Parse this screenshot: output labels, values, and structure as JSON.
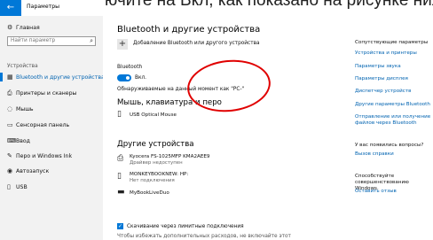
{
  "top_caption": "ючите на Вкл, как показано на рисунке ниже",
  "window": {
    "title": "Параметры"
  },
  "sidebar": {
    "home": "Главная",
    "search_placeholder": "Найти параметр",
    "section": "Устройства",
    "items": [
      {
        "label": "Bluetooth и другие устройства",
        "icon": "bluetooth-icon"
      },
      {
        "label": "Принтеры и сканеры",
        "icon": "printer-icon"
      },
      {
        "label": "Мышь",
        "icon": "mouse-icon"
      },
      {
        "label": "Сенсорная панель",
        "icon": "touchpad-icon"
      },
      {
        "label": "Ввод",
        "icon": "keyboard-icon"
      },
      {
        "label": "Перо и Windows Ink",
        "icon": "pen-icon"
      },
      {
        "label": "Автозапуск",
        "icon": "autoplay-icon"
      },
      {
        "label": "USB",
        "icon": "usb-icon"
      }
    ]
  },
  "main": {
    "title": "Bluetooth и другие устройства",
    "add_device": "Добавление Bluetooth или другого устройства",
    "bt_label": "Bluetooth",
    "bt_state": "Вкл.",
    "discoverable": "Обнаруживаемые на данный момент как \"PC-\"",
    "mouse_heading": "Мышь, клавиатура и перо",
    "mouse_device": "USB Optical Mouse",
    "other_heading": "Другие устройства",
    "devices": [
      {
        "name": "Kyocera FS-1025MFP KMA2AEE9",
        "status": "Драйвер недоступен"
      },
      {
        "name": "MONKEYBOOKNEW: HP:",
        "status": "Нет подключения"
      },
      {
        "name": "MyBookLiveDuo",
        "status": ""
      }
    ],
    "metered": "Скачивание через лимитные подключения",
    "metered_note": "Чтобы избежать дополнительных расходов, не включайте этот"
  },
  "right": {
    "related_heading": "Сопутствующие параметры",
    "links": [
      "Устройства и принтеры",
      "Параметры звука",
      "Параметры дисплея",
      "Диспетчер устройств",
      "Другие параметры Bluetooth",
      "Отправление или получение файлов через Bluetooth"
    ],
    "question": "У вас появились вопросы?",
    "help": "Вызов справки",
    "improve": "Способствуйте совершенствованию Windows.",
    "feedback": "Оставить отзыв"
  },
  "colors": {
    "accent": "#0078d7",
    "annotation": "#e00000",
    "sidebar_bg": "#f2f2f2"
  }
}
